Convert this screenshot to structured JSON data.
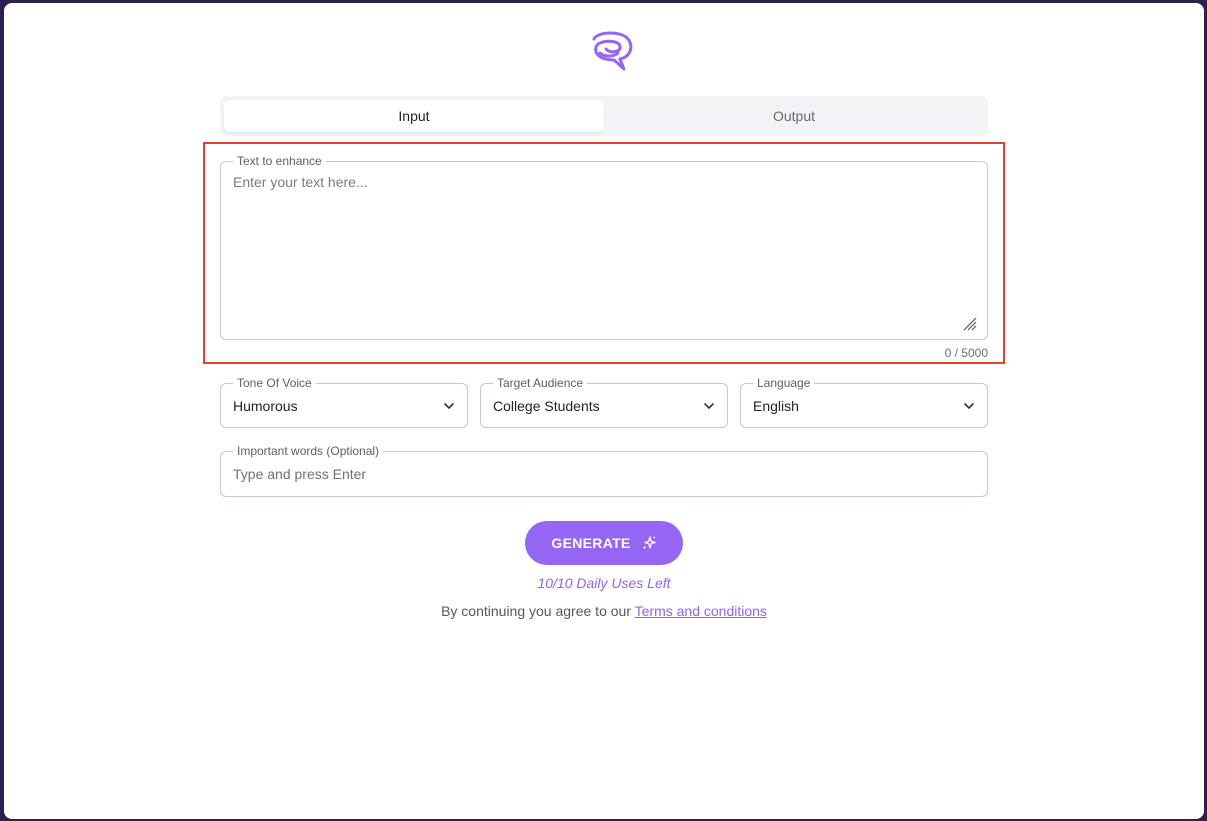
{
  "tabs": [
    {
      "label": "Input",
      "active": true
    },
    {
      "label": "Output",
      "active": false
    }
  ],
  "text_field": {
    "legend": "Text to enhance",
    "placeholder": "Enter your text here...",
    "value": "",
    "counter": "0 / 5000"
  },
  "selects": {
    "tone": {
      "legend": "Tone Of Voice",
      "value": "Humorous"
    },
    "audience": {
      "legend": "Target Audience",
      "value": "College Students"
    },
    "language": {
      "legend": "Language",
      "value": "English"
    }
  },
  "keywords": {
    "legend": "Important words (Optional)",
    "placeholder": "Type and press Enter"
  },
  "generate": {
    "label": "GENERATE",
    "icon": "sparkles-icon"
  },
  "uses_left": "10/10 Daily Uses Left",
  "terms": {
    "prefix": "By continuing you agree to our ",
    "link": "Terms and conditions"
  },
  "colors": {
    "accent": "#9466f3",
    "accent_text": "#8e63ee",
    "highlight": "#e5402f",
    "frame_bg": "#2b2050"
  }
}
